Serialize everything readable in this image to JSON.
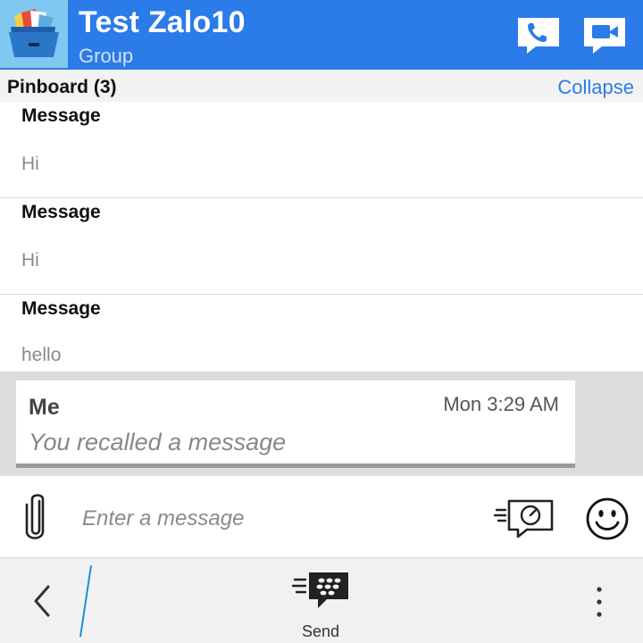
{
  "header": {
    "title": "Test Zalo10",
    "subtitle": "Group",
    "avatar_icon": "folder-avatar-icon",
    "actions": [
      {
        "name": "call-button",
        "icon": "phone-icon"
      },
      {
        "name": "video-call-button",
        "icon": "video-camera-icon"
      }
    ],
    "colors": {
      "background": "#2b7be8",
      "avatar_bg": "#7ec8f2"
    }
  },
  "pinboard": {
    "title": "Pinboard (3)",
    "collapse_label": "Collapse",
    "items": [
      {
        "title": "Message",
        "text": "Hi"
      },
      {
        "title": "Message",
        "text": "Hi"
      },
      {
        "title": "Message",
        "text": "hello"
      }
    ]
  },
  "chat": {
    "messages": [
      {
        "sender": "Me",
        "time": "Mon 3:29 AM",
        "text": "You recalled a message"
      }
    ]
  },
  "composer": {
    "placeholder": "Enter a message",
    "attach_icon": "paperclip-icon",
    "timed_icon": "timed-message-icon",
    "emoji_icon": "smiley-icon"
  },
  "actionbar": {
    "back_icon": "chevron-left-icon",
    "send_label": "Send",
    "send_icon": "bbm-send-icon",
    "overflow_icon": "more-vertical-icon"
  },
  "colors": {
    "accent": "#2b7be8"
  }
}
